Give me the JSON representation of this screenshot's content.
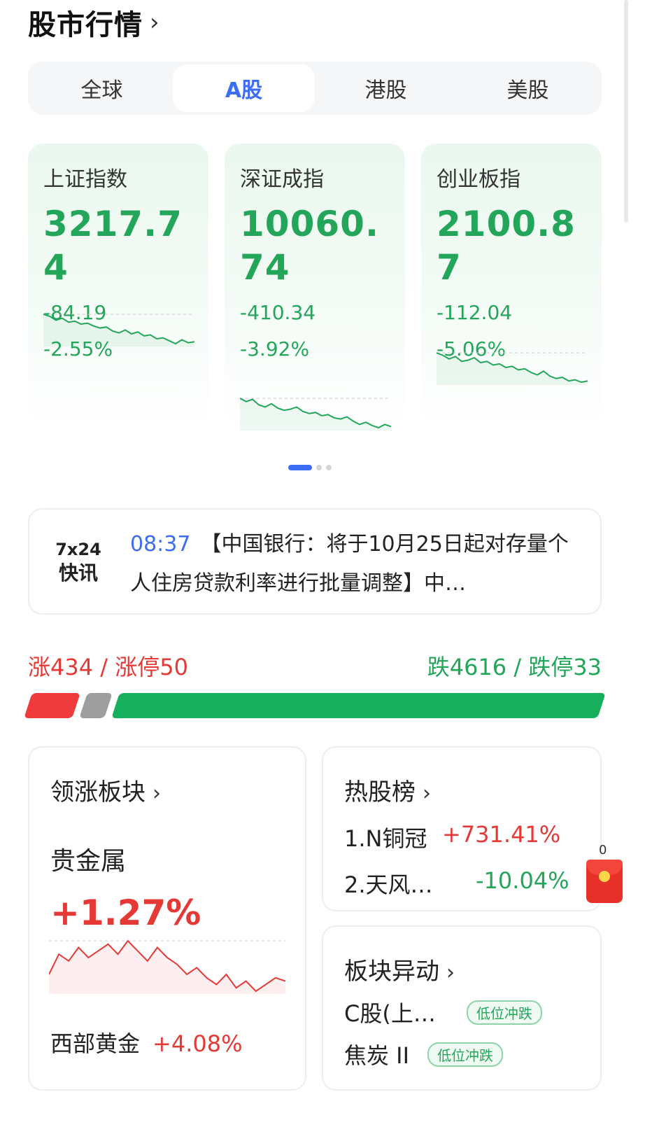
{
  "header": {
    "title": "股市行情",
    "chevron": "›"
  },
  "tabs": [
    {
      "label": "全球",
      "active": false
    },
    {
      "label": "A股",
      "active": true
    },
    {
      "label": "港股",
      "active": false
    },
    {
      "label": "美股",
      "active": false
    }
  ],
  "indices": [
    {
      "name": "上证指数",
      "value": "3217.74",
      "change": "-84.19",
      "pct": "-2.55%",
      "spark": [
        8,
        10,
        14,
        12,
        16,
        15,
        18,
        17,
        20,
        22,
        21,
        25,
        27,
        24,
        28,
        26,
        30,
        29,
        33,
        32,
        35,
        38,
        34,
        37,
        36
      ]
    },
    {
      "name": "深证成指",
      "value": "10060.74",
      "change": "-410.34",
      "pct": "-3.92%",
      "spark": [
        9,
        12,
        10,
        15,
        17,
        14,
        18,
        20,
        19,
        17,
        21,
        23,
        22,
        25,
        24,
        27,
        28,
        26,
        30,
        33,
        31,
        34,
        36,
        33,
        35
      ]
    },
    {
      "name": "创业板指",
      "value": "2100.87",
      "change": "-112.04",
      "pct": "-5.06%",
      "spark": [
        10,
        12,
        15,
        13,
        17,
        16,
        14,
        18,
        17,
        20,
        19,
        22,
        21,
        24,
        23,
        26,
        28,
        25,
        29,
        31,
        30,
        33,
        32,
        34,
        33
      ]
    }
  ],
  "news": {
    "badge_line1": "7x24",
    "badge_line2": "快讯",
    "time": "08:37",
    "text": "【中国银行：将于10月25日起对存量个人住房贷款利率进行批量调整】中…"
  },
  "breadth": {
    "up_label": "涨434 / 涨停50",
    "down_label": "跌4616 / 跌停33",
    "up_count": 434,
    "flat_count": 0,
    "down_count": 4616,
    "colors": {
      "up": "#ef3b3b",
      "flat": "#9e9e9e",
      "down": "#16b05c"
    }
  },
  "leader": {
    "title": "领涨板块",
    "chevron": "›",
    "sector": "贵金属",
    "pct": "+1.27%",
    "stock": "西部黄金",
    "stock_pct": "+4.08%",
    "spark": [
      30,
      24,
      26,
      22,
      25,
      23,
      21,
      24,
      20,
      23,
      26,
      22,
      25,
      27,
      30,
      28,
      31,
      33,
      30,
      34,
      32,
      35,
      33,
      31,
      32
    ]
  },
  "hot": {
    "title": "热股榜",
    "chevron": "›",
    "items": [
      {
        "name": "1.N铜冠",
        "pct": "+731.41%"
      },
      {
        "name": "2.天风…",
        "pct": "-10.04%"
      }
    ]
  },
  "moves": {
    "title": "板块异动",
    "chevron": "›",
    "items": [
      {
        "name": "C股(上…",
        "tag": "低位冲跌"
      },
      {
        "name": "焦炭 II",
        "tag": "低位冲跌"
      }
    ]
  },
  "redpacket": {
    "count": "0"
  }
}
